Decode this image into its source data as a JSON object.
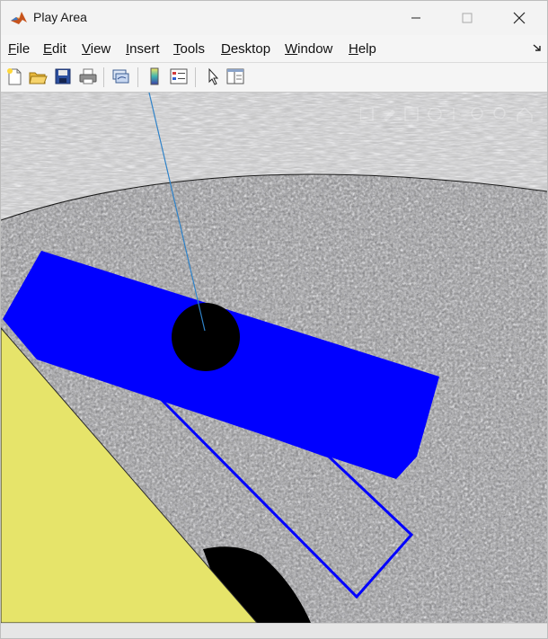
{
  "window": {
    "title": "Play Area",
    "icon": "matlab-icon",
    "controls": [
      "minimize-icon",
      "maximize-icon",
      "close-icon"
    ]
  },
  "menubar": {
    "items": [
      "File",
      "Edit",
      "View",
      "Insert",
      "Tools",
      "Desktop",
      "Window",
      "Help"
    ]
  },
  "toolbar": {
    "buttons": [
      "new-figure-icon",
      "open-file-icon",
      "save-icon",
      "print-icon",
      "link-plot-icon",
      "colorbar-icon",
      "legend-icon",
      "edit-plot-arrow-icon",
      "property-inspector-icon"
    ]
  },
  "scene": {
    "floor_color": "#8e8e8e",
    "wall_color": "#c2c2c2",
    "paddle_color": "#0000ff",
    "ball_color": "#000000",
    "obstacle_color": "#e6e46a",
    "axes_toolbar_icons": [
      "export-icon",
      "brush-icon",
      "data-tip-icon",
      "rotate-icon",
      "pan-icon",
      "zoom-in-icon",
      "zoom-out-icon",
      "home-icon"
    ]
  }
}
